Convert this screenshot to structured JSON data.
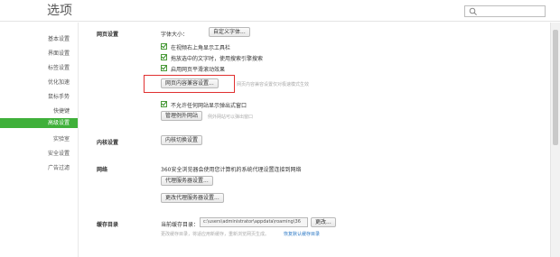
{
  "header": {
    "title": "选项",
    "search_placeholder": ""
  },
  "sidebar": {
    "items": [
      {
        "label": "基本设置"
      },
      {
        "label": "界面设置"
      },
      {
        "label": "标签设置"
      },
      {
        "label": "优化加速"
      },
      {
        "label": "鼠标手势"
      },
      {
        "label": "快捷键"
      },
      {
        "label": "高级设置"
      },
      {
        "label": "实验室"
      },
      {
        "label": "安全设置"
      },
      {
        "label": "广告过滤"
      }
    ]
  },
  "webpage": {
    "heading": "网页设置",
    "font_size_label": "字体大小：",
    "custom_font_button": "自定义字体...",
    "options": [
      "在视频右上角显示工具栏",
      "拖放选中的文字时，使用搜索引擎搜索",
      "启用网页平滑滚动效果"
    ],
    "compat_button": "网页内容兼容设置...",
    "compat_hint": "网页内容兼容设置仅对极速模式生效",
    "popup_option": "不允许任何网站显示弹出式窗口",
    "exceptions_button": "管理例外网站",
    "exceptions_hint": "例外网站可以弹出窗口"
  },
  "kernel": {
    "heading": "内核设置",
    "button": "内核切换设置"
  },
  "network": {
    "heading": "网络",
    "desc": "360安全浏览器会使用您计算机的系统代理设置连接到网络",
    "proxy_button": "代理服务器设置...",
    "change_proxy_button": "更改代理服务器设置..."
  },
  "cache": {
    "heading": "缓存目录",
    "current_label": "当前缓存目录：",
    "path": "c:\\users\\administrator\\appdata\\roaming\\36",
    "change_button": "更改...",
    "note": "更改缓存目录，将适应用新缓存，重新浏览网页生成。",
    "restore_link": "恢复默认缓存目录"
  },
  "colors": {
    "accent": "#3fb03a",
    "highlight": "#e03030",
    "link": "#2b78c5"
  },
  "icons": {
    "search": "search-icon",
    "checkbox": "checkmark-icon"
  }
}
